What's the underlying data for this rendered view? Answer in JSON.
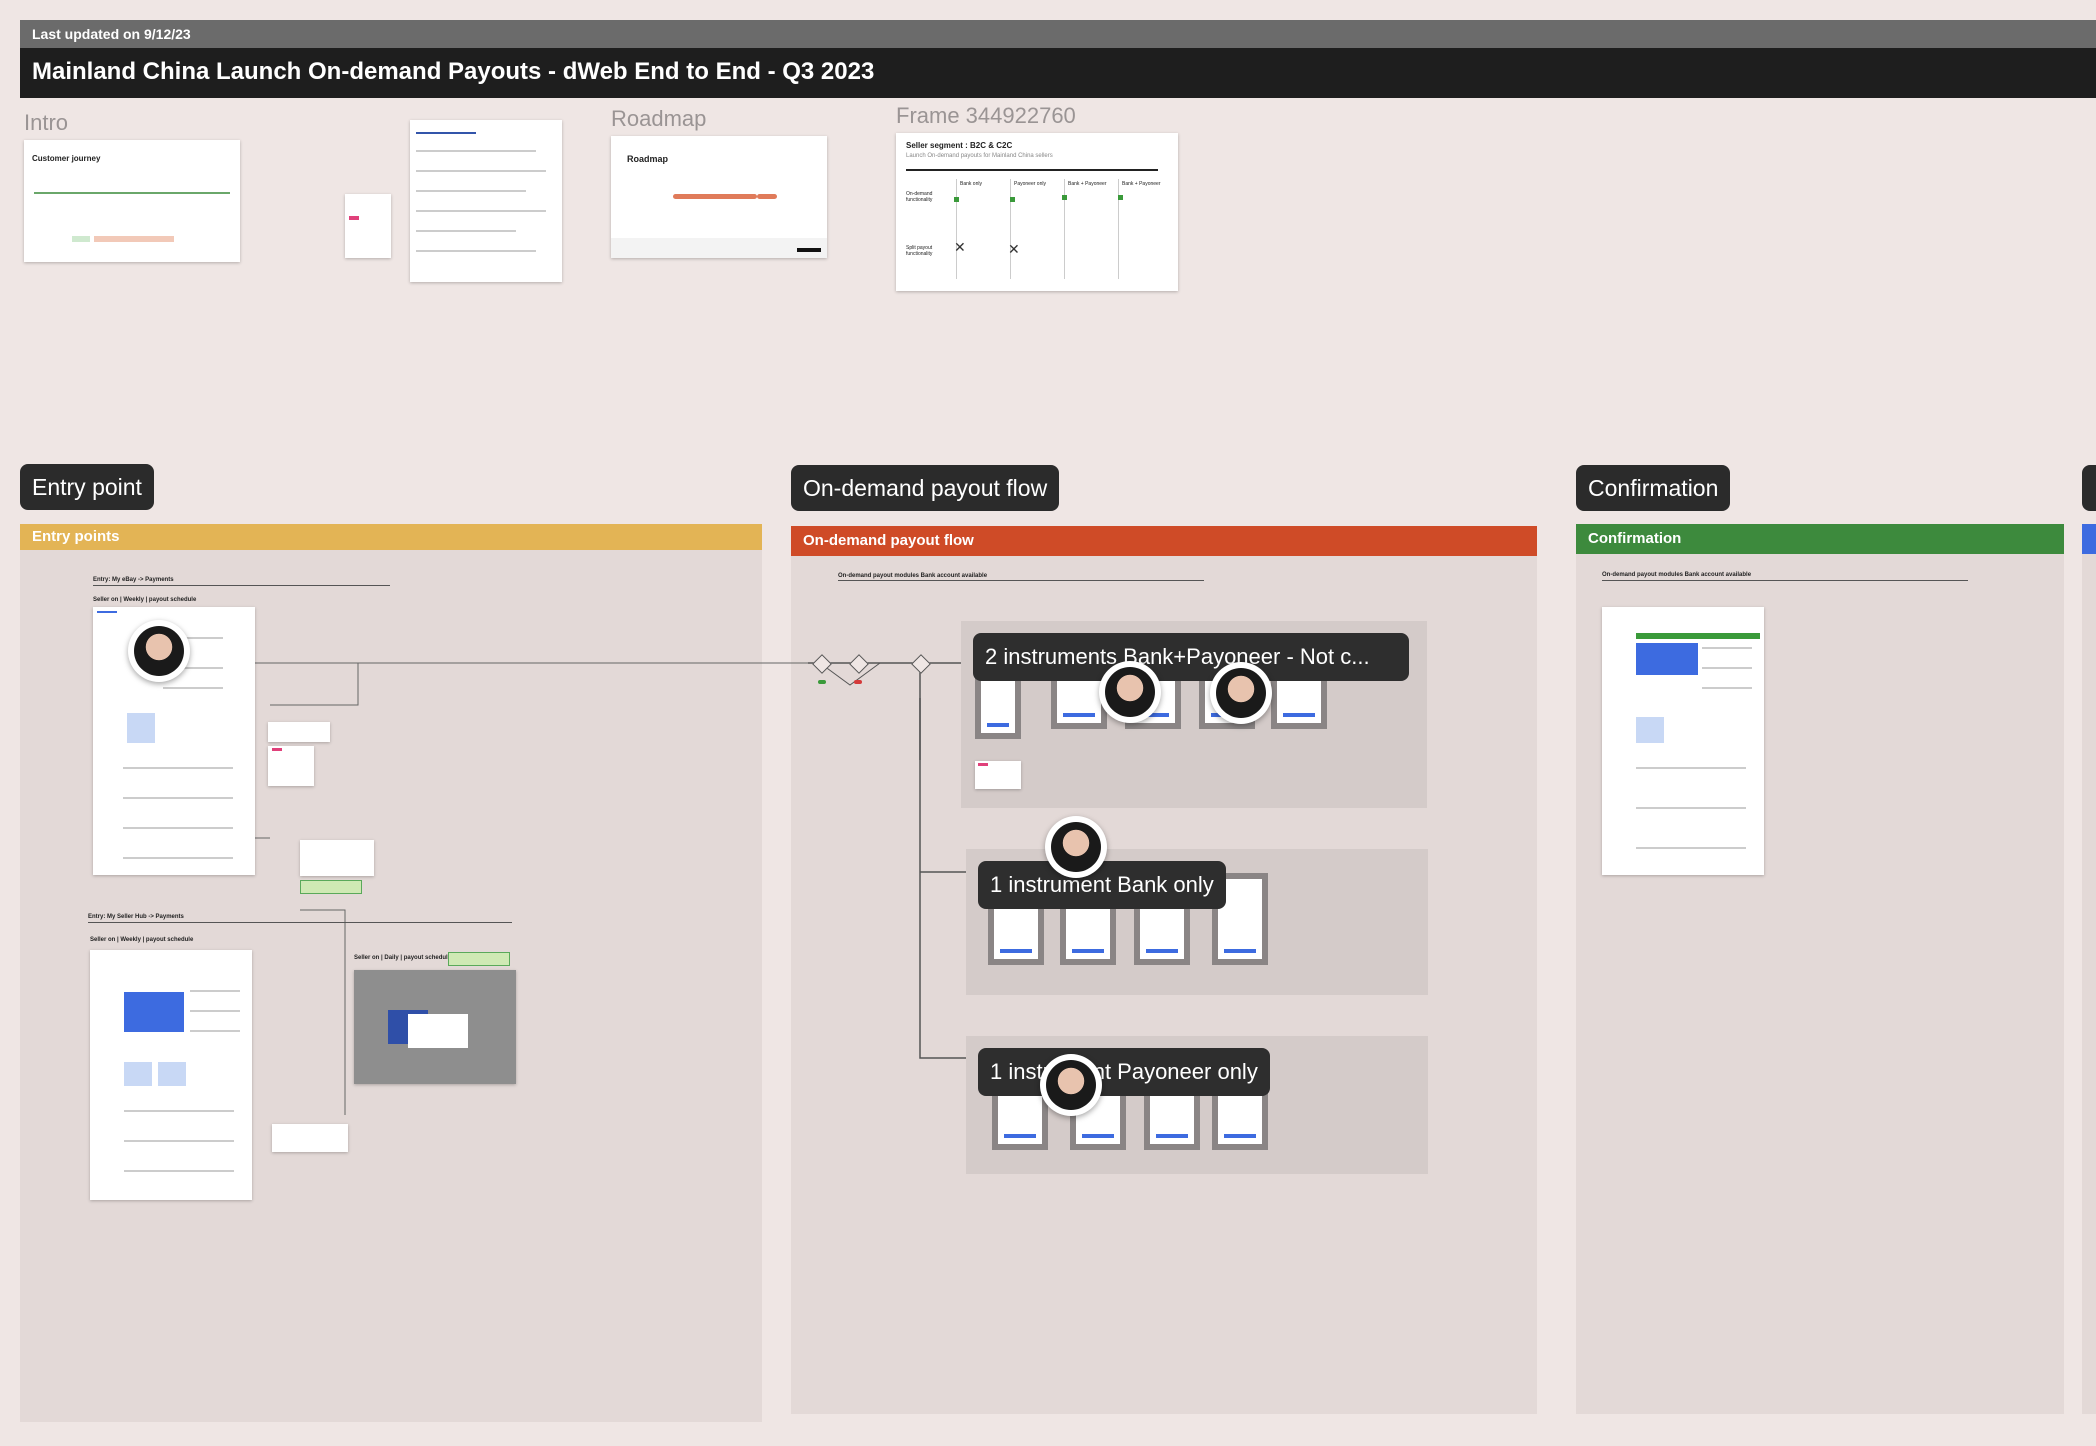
{
  "header": {
    "last_updated": "Last updated on 9/12/23",
    "title": "Mainland China Launch On-demand Payouts - dWeb End to End - Q3 2023"
  },
  "top_frames": {
    "intro_label": "Intro",
    "roadmap_label": "Roadmap",
    "frame_label": "Frame 344922760",
    "customer_journey_title": "Customer journey",
    "roadmap_card_title": "Roadmap",
    "seller_segment_title": "Seller segment : B2C & C2C",
    "seller_segment_subtitle": "Launch On-demand payouts for Mainland China sellers",
    "segment_columns": [
      "Bank only",
      "Payoneer only",
      "Bank + Payoneer",
      "Bank + Payoneer"
    ],
    "segment_rows": [
      "On-demand functionality",
      "Split payout functionality"
    ]
  },
  "sections": {
    "entry_point": {
      "tag": "Entry point",
      "band": "Entry points",
      "band_color": "#e3b455"
    },
    "on_demand": {
      "tag": "On-demand payout flow",
      "band": "On-demand payout flow",
      "band_color": "#cf4b27",
      "heading": "On-demand payout modules Bank account available"
    },
    "confirmation": {
      "tag": "Confirmation",
      "band": "Confirmation",
      "band_color": "#3d8a3d",
      "heading": "On-demand payout modules Bank account available"
    }
  },
  "entry_labels": {
    "entry1": "Entry: My eBay -> Payments",
    "entry1_sub": "Seller on | Weekly | payout schedule",
    "entry2": "Entry: My Seller Hub -> Payments",
    "entry2_sub": "Seller on | Weekly | payout schedule",
    "entry3_sub": "Seller on | Daily | payout schedule"
  },
  "flow_labels": {
    "bank_payoneer": "2 instruments Bank+Payoneer - Not c...",
    "bank_only": "1 instrument Bank only",
    "payoneer_only": "1 instrument Payoneer only"
  }
}
